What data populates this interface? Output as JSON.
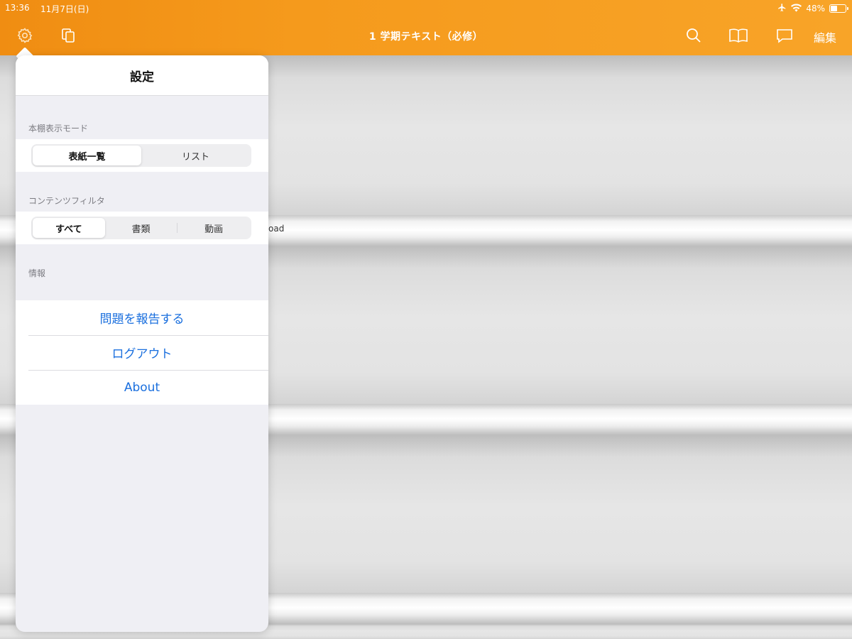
{
  "status_bar": {
    "time": "13:36",
    "date": "11月7日(日)",
    "battery_percent": "48%",
    "battery_level": 0.48
  },
  "nav": {
    "title": "1 学期テキスト（必修）",
    "edit_label": "編集",
    "accent_color": "#f59a1c",
    "icons": [
      "gear-icon",
      "copy-icon",
      "search-icon",
      "book-icon",
      "comment-icon"
    ]
  },
  "background": {
    "stray_text": "oad"
  },
  "settings": {
    "title": "設定",
    "display_mode": {
      "label": "本棚表示モード",
      "options": [
        "表紙一覧",
        "リスト"
      ],
      "selected": "表紙一覧"
    },
    "content_filter": {
      "label": "コンテンツフィルタ",
      "options": [
        "すべて",
        "書類",
        "動画"
      ],
      "selected": "すべて"
    },
    "info": {
      "label": "情報",
      "actions": [
        "問題を報告する",
        "ログアウト",
        "About"
      ],
      "action_color": "#1a6fde"
    }
  }
}
